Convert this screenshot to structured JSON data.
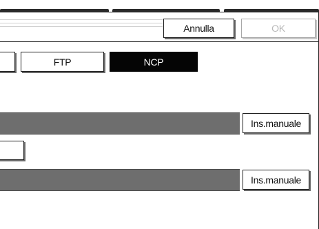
{
  "header": {
    "cancel_label": "Annulla",
    "ok_label": "OK"
  },
  "protocol": {
    "options": [
      {
        "label": ""
      },
      {
        "label": "FTP"
      },
      {
        "label": "NCP"
      }
    ],
    "selected": "NCP"
  },
  "fields": [
    {
      "value": "",
      "manual_label": "Ins.manuale"
    },
    {
      "value": "",
      "manual_label": "Ins.manuale"
    }
  ],
  "colors": {
    "selected_bg": "#050505",
    "field_bg": "#6e6e6e"
  }
}
